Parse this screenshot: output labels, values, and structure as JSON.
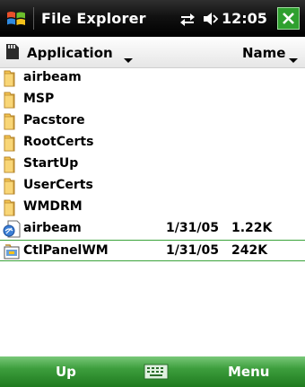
{
  "titlebar": {
    "title": "File Explorer",
    "time": "12:05",
    "start_icon": "windows-flag-icon",
    "connectivity_icon": "connectivity-icon",
    "volume_icon": "volume-icon",
    "close_icon": "close-icon",
    "close_color": "#2fa02f"
  },
  "header": {
    "folder_selector": "Application",
    "sort_selector": "Name",
    "storage_icon": "storage-card-icon"
  },
  "files": [
    {
      "name": "airbeam",
      "type": "folder",
      "date": "",
      "size": ""
    },
    {
      "name": "MSP",
      "type": "folder",
      "date": "",
      "size": ""
    },
    {
      "name": "Pacstore",
      "type": "folder",
      "date": "",
      "size": ""
    },
    {
      "name": "RootCerts",
      "type": "folder",
      "date": "",
      "size": ""
    },
    {
      "name": "StartUp",
      "type": "folder",
      "date": "",
      "size": ""
    },
    {
      "name": "UserCerts",
      "type": "folder",
      "date": "",
      "size": ""
    },
    {
      "name": "WMDRM",
      "type": "folder",
      "date": "",
      "size": ""
    },
    {
      "name": "airbeam",
      "type": "file",
      "date": "1/31/05",
      "size": "1.22K"
    },
    {
      "name": "CtlPanelWM",
      "type": "file",
      "date": "1/31/05",
      "size": "242K"
    }
  ],
  "selected_index": 8,
  "softkeys": {
    "left": "Up",
    "right": "Menu",
    "center_icon": "keyboard-icon"
  },
  "colors": {
    "accent_green": "#3d9e3d",
    "folder_yellow": "#f2c14e",
    "titlebar": "#000000"
  }
}
